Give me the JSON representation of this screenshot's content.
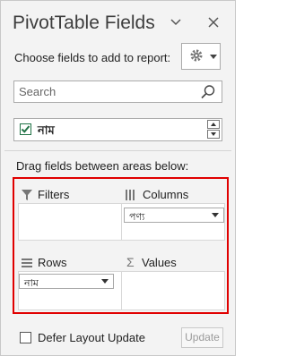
{
  "panel": {
    "title": "PivotTable Fields",
    "choose_label": "Choose fields to add to report:"
  },
  "search": {
    "placeholder": "Search",
    "value": ""
  },
  "fields": [
    {
      "name": "নাম",
      "checked": true
    }
  ],
  "areas": {
    "instruction": "Drag fields between areas below:",
    "filters": {
      "label": "Filters",
      "items": []
    },
    "columns": {
      "label": "Columns",
      "items": [
        "পণ্য"
      ]
    },
    "rows": {
      "label": "Rows",
      "items": [
        "নাম"
      ]
    },
    "values": {
      "label": "Values",
      "items": []
    }
  },
  "footer": {
    "defer_label": "Defer Layout Update",
    "update_label": "Update"
  },
  "colors": {
    "highlight_border": "#e00000",
    "checkbox_green": "#217346"
  }
}
